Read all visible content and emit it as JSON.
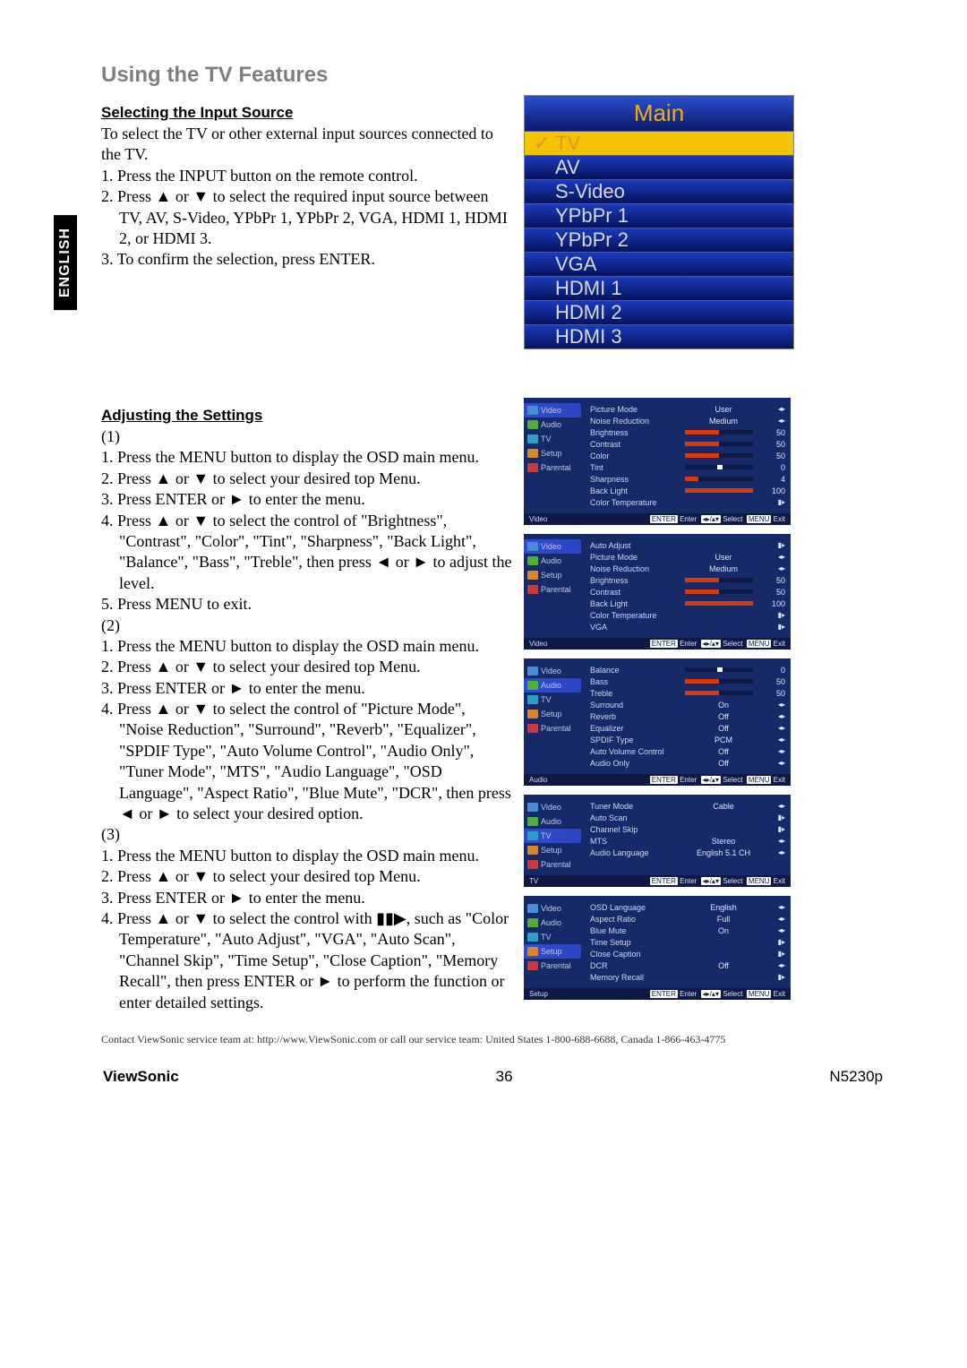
{
  "lang_tab": "ENGLISH",
  "heading": "Using the TV Features",
  "section1": {
    "title": "Selecting the Input Source",
    "intro": "To select the TV or other external input sources connected to the TV.",
    "steps": [
      "1. Press the INPUT button on the remote control.",
      "2. Press ▲ or ▼ to select the required input source between TV, AV, S-Video, YPbPr 1, YPbPr 2, VGA, HDMI 1, HDMI 2, or HDMI 3.",
      "3. To confirm the selection, press ENTER."
    ],
    "main_menu": {
      "title": "Main",
      "items": [
        "TV",
        "AV",
        "S-Video",
        "YPbPr 1",
        "YPbPr 2",
        "VGA",
        "HDMI 1",
        "HDMI 2",
        "HDMI 3"
      ],
      "selected": "TV"
    }
  },
  "section2": {
    "title": "Adjusting the Settings",
    "groups": [
      {
        "label": "(1)",
        "steps": [
          "1. Press the MENU button to display the OSD main menu.",
          "2. Press ▲ or ▼ to select your desired top Menu.",
          "3. Press ENTER or ► to enter the menu.",
          "4. Press ▲ or ▼ to select the control of \"Brightness\", \"Contrast\", \"Color\", \"Tint\", \"Sharpness\", \"Back Light\", \"Balance\", \"Bass\", \"Treble\", then press ◄ or ► to adjust the level.",
          "5. Press MENU to exit."
        ]
      },
      {
        "label": "(2)",
        "steps": [
          "1. Press the MENU button to display the OSD main menu.",
          "2. Press ▲ or ▼ to select your desired top Menu.",
          "3. Press ENTER or ► to enter the menu.",
          "4. Press ▲ or ▼ to select the control of \"Picture Mode\", \"Noise Reduction\", \"Surround\", \"Reverb\", \"Equalizer\", \"SPDIF Type\", \"Auto Volume Control\", \"Audio Only\", \"Tuner Mode\", \"MTS\", \"Audio Language\", \"OSD Language\", \"Aspect Ratio\", \"Blue Mute\", \"DCR\", then press ◄ or ► to select your desired option."
        ]
      },
      {
        "label": "(3)",
        "steps": [
          "1. Press the MENU button to display the OSD main menu.",
          "2. Press ▲ or ▼ to select your desired top Menu.",
          "3. Press ENTER or ► to enter the menu.",
          "4. Press ▲ or ▼ to select the control with ▮▮▶, such as \"Color Temperature\", \"Auto Adjust\", \"VGA\", \"Auto Scan\", \"Channel Skip\", \"Time Setup\", \"Close Caption\", \"Memory Recall\", then press ENTER or ► to perform the function or enter detailed settings."
        ]
      }
    ]
  },
  "osd_nav_labels": {
    "video": "Video",
    "audio": "Audio",
    "tv": "TV",
    "setup": "Setup",
    "parental": "Parental"
  },
  "osd_footer": {
    "left": "",
    "enter": "ENTER Enter",
    "nav": "◄►/◂▸ Select",
    "menu": "MENU Exit"
  },
  "osd_panels": [
    {
      "active": "video",
      "nav": [
        "video",
        "audio",
        "tv",
        "setup",
        "parental"
      ],
      "footer_tag": "Video",
      "rows": [
        {
          "label": "Picture Mode",
          "val": "User",
          "arrow": "◂▸"
        },
        {
          "label": "Noise Reduction",
          "val": "Medium",
          "arrow": "◂▸"
        },
        {
          "label": "Brightness",
          "slider": 50,
          "num": "50"
        },
        {
          "label": "Contrast",
          "slider": 50,
          "num": "50"
        },
        {
          "label": "Color",
          "slider": 50,
          "num": "50"
        },
        {
          "label": "Tint",
          "slider": 50,
          "num": "0",
          "tint": true
        },
        {
          "label": "Sharpness",
          "slider": 20,
          "num": "4"
        },
        {
          "label": "Back Light",
          "slider": 100,
          "num": "100"
        },
        {
          "label": "Color Temperature",
          "val": "",
          "arrow": "▮▸"
        }
      ]
    },
    {
      "active": "video",
      "nav": [
        "video",
        "audio",
        "setup",
        "parental"
      ],
      "footer_tag": "Video",
      "rows": [
        {
          "label": "Auto Adjust",
          "val": "",
          "arrow": "▮▸"
        },
        {
          "label": "Picture Mode",
          "val": "User",
          "arrow": "◂▸"
        },
        {
          "label": "Noise Reduction",
          "val": "Medium",
          "arrow": "◂▸"
        },
        {
          "label": "Brightness",
          "slider": 50,
          "num": "50"
        },
        {
          "label": "Contrast",
          "slider": 50,
          "num": "50"
        },
        {
          "label": "Back Light",
          "slider": 100,
          "num": "100"
        },
        {
          "label": "Color Temperature",
          "val": "",
          "arrow": "▮▸"
        },
        {
          "label": "VGA",
          "val": "",
          "arrow": "▮▸"
        }
      ]
    },
    {
      "active": "audio",
      "nav": [
        "video",
        "audio",
        "tv",
        "setup",
        "parental"
      ],
      "footer_tag": "Audio",
      "rows": [
        {
          "label": "Balance",
          "slider": 50,
          "num": "0",
          "tint": true
        },
        {
          "label": "Bass",
          "slider": 50,
          "num": "50"
        },
        {
          "label": "Treble",
          "slider": 50,
          "num": "50"
        },
        {
          "label": "Surround",
          "val": "On",
          "arrow": "◂▸"
        },
        {
          "label": "Reverb",
          "val": "Off",
          "arrow": "◂▸"
        },
        {
          "label": "Equalizer",
          "val": "Off",
          "arrow": "◂▸"
        },
        {
          "label": "SPDIF Type",
          "val": "PCM",
          "arrow": "◂▸"
        },
        {
          "label": "Auto Volume Control",
          "val": "Off",
          "arrow": "◂▸"
        },
        {
          "label": "Audio Only",
          "val": "Off",
          "arrow": "◂▸"
        }
      ]
    },
    {
      "active": "tv",
      "nav": [
        "video",
        "audio",
        "tv",
        "setup",
        "parental"
      ],
      "footer_tag": "TV",
      "rows": [
        {
          "label": "Tuner Mode",
          "val": "Cable",
          "arrow": "◂▸"
        },
        {
          "label": "Auto Scan",
          "val": "",
          "arrow": "▮▸"
        },
        {
          "label": "Channel Skip",
          "val": "",
          "arrow": "▮▸"
        },
        {
          "label": "MTS",
          "val": "Stereo",
          "arrow": "◂▸"
        },
        {
          "label": "Audio Language",
          "val": "English 5.1 CH",
          "arrow": "◂▸"
        }
      ]
    },
    {
      "active": "setup",
      "nav": [
        "video",
        "audio",
        "tv",
        "setup",
        "parental"
      ],
      "footer_tag": "Setup",
      "rows": [
        {
          "label": "OSD Language",
          "val": "English",
          "arrow": "◂▸"
        },
        {
          "label": "Aspect Ratio",
          "val": "Full",
          "arrow": "◂▸"
        },
        {
          "label": "Blue Mute",
          "val": "On",
          "arrow": "◂▸"
        },
        {
          "label": "Time Setup",
          "val": "",
          "arrow": "▮▸"
        },
        {
          "label": "Close Caption",
          "val": "",
          "arrow": "▮▸"
        },
        {
          "label": "DCR",
          "val": "Off",
          "arrow": "◂▸"
        },
        {
          "label": "Memory Recall",
          "val": "",
          "arrow": "▮▸"
        }
      ]
    }
  ],
  "contact": "Contact ViewSonic service team at: http://www.ViewSonic.com or call our service team: United States 1-800-688-6688, Canada 1-866-463-4775",
  "footer": {
    "brand": "ViewSonic",
    "page": "36",
    "model": "N5230p"
  }
}
